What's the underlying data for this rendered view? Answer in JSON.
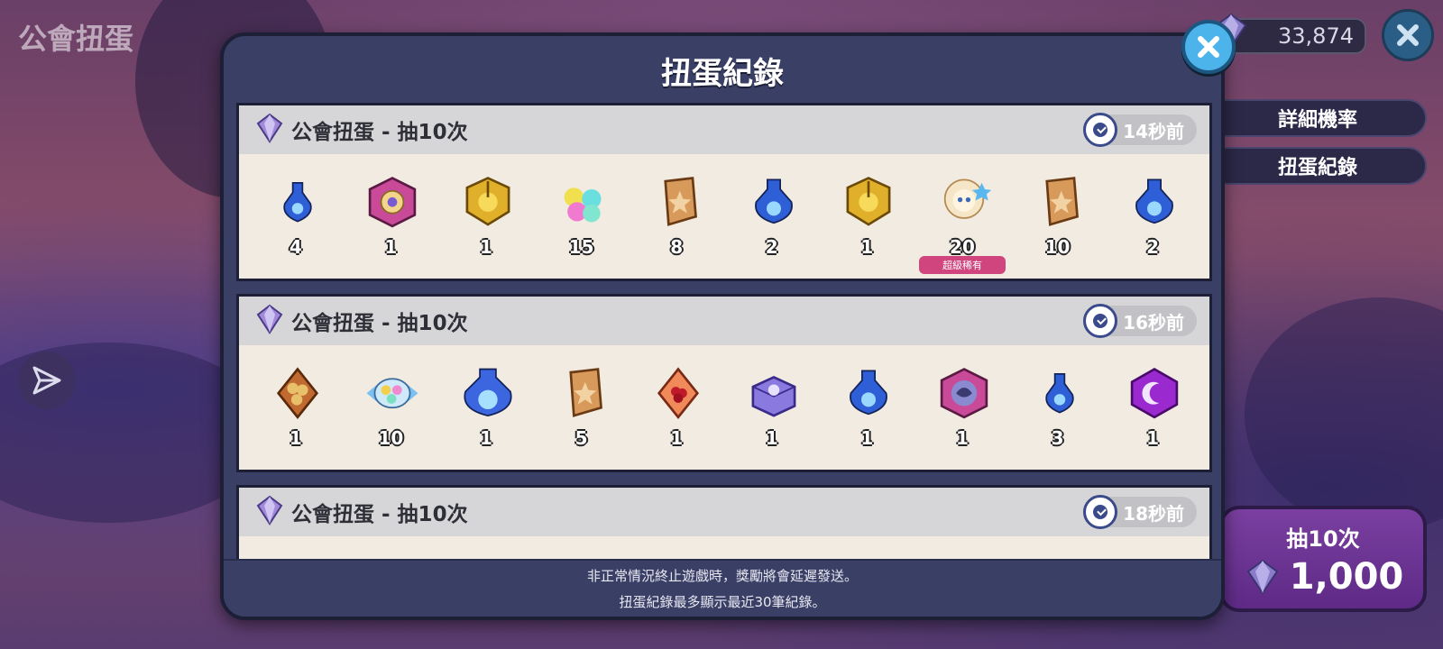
{
  "screen": {
    "title": "公會扭蛋"
  },
  "currency": {
    "amount": "33,874"
  },
  "side": {
    "rates_label": "詳細機率",
    "history_label": "扭蛋紀錄"
  },
  "draw": {
    "label": "抽10次",
    "cost": "1,000"
  },
  "modal": {
    "title": "扭蛋紀錄",
    "footer_line1": "非正常情況終止遊戲時，獎勵將會延遲發送。",
    "footer_line2": "扭蛋紀錄最多顯示最近30筆紀錄。"
  },
  "records": [
    {
      "title": "公會扭蛋 - 抽10次",
      "time": "14秒前",
      "items": [
        {
          "icon": "blue-potion-small-icon",
          "qty": "4"
        },
        {
          "icon": "pink-amulet-icon",
          "qty": "1"
        },
        {
          "icon": "gold-emblem-icon",
          "qty": "1"
        },
        {
          "icon": "flower-candy-icon",
          "qty": "15"
        },
        {
          "icon": "star-cookie-card-icon",
          "qty": "8"
        },
        {
          "icon": "blue-potion-icon",
          "qty": "2"
        },
        {
          "icon": "gold-emblem-icon",
          "qty": "1"
        },
        {
          "icon": "cream-cookie-character-icon",
          "qty": "20",
          "badge": "超級稀有"
        },
        {
          "icon": "star-cookie-card-icon",
          "qty": "10"
        },
        {
          "icon": "blue-potion-icon",
          "qty": "2"
        }
      ]
    },
    {
      "title": "公會扭蛋 - 抽10次",
      "time": "16秒前",
      "items": [
        {
          "icon": "nut-card-icon",
          "qty": "1"
        },
        {
          "icon": "candy-bundle-icon",
          "qty": "10"
        },
        {
          "icon": "large-blue-potion-icon",
          "qty": "1"
        },
        {
          "icon": "star-cookie-card-icon",
          "qty": "5"
        },
        {
          "icon": "red-berry-card-icon",
          "qty": "1"
        },
        {
          "icon": "purple-chest-icon",
          "qty": "1"
        },
        {
          "icon": "blue-potion-icon",
          "qty": "1"
        },
        {
          "icon": "pink-dragon-amulet-icon",
          "qty": "1"
        },
        {
          "icon": "blue-potion-small-icon",
          "qty": "3"
        },
        {
          "icon": "purple-moon-gem-icon",
          "qty": "1"
        }
      ]
    },
    {
      "title": "公會扭蛋 - 抽10次",
      "time": "18秒前",
      "items": []
    }
  ],
  "colors": {
    "modal_bg": "#3a3f65",
    "card_bg": "#f2ebe1",
    "card_header": "#d6d6d8",
    "draw_button": "#6a3494",
    "close_button": "#4cb4ea",
    "rare_tag": "#d0457e"
  }
}
